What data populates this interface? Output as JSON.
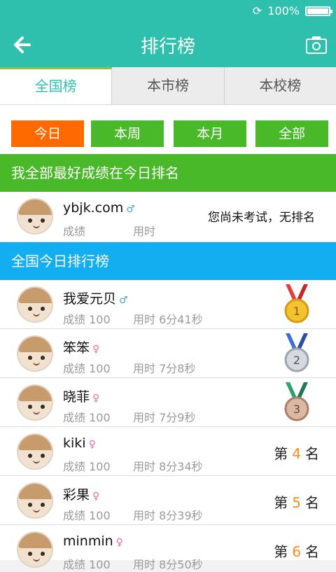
{
  "status": {
    "battery": "100%"
  },
  "header": {
    "title": "排行榜"
  },
  "tabs": [
    {
      "label": "全国榜",
      "active": true
    },
    {
      "label": "本市榜",
      "active": false
    },
    {
      "label": "本校榜",
      "active": false
    }
  ],
  "filters": [
    {
      "label": "今日",
      "active": true
    },
    {
      "label": "本周",
      "active": false
    },
    {
      "label": "本月",
      "active": false
    },
    {
      "label": "全部",
      "active": false
    }
  ],
  "my_section": {
    "title": "我全部最好成绩在今日排名"
  },
  "my_row": {
    "name": "ybjk.com",
    "gender": "♂",
    "score_label": "成绩",
    "time_label": "用时",
    "status": "您尚未考试，无排名"
  },
  "national_section": {
    "title": "全国今日排行榜"
  },
  "ranking": [
    {
      "name": "我爱元贝",
      "gender": "♂",
      "score": "成绩 100",
      "time": "用时 6分41秒",
      "rank": "1",
      "medal": "gold"
    },
    {
      "name": "笨笨",
      "gender": "♀",
      "score": "成绩 100",
      "time": "用时 7分8秒",
      "rank": "2",
      "medal": "silver"
    },
    {
      "name": "晓菲",
      "gender": "♀",
      "score": "成绩 100",
      "time": "用时 7分9秒",
      "rank": "3",
      "medal": "bronze"
    },
    {
      "name": "kiki",
      "gender": "♀",
      "score": "成绩 100",
      "time": "用时 8分34秒",
      "rank_prefix": "第",
      "rank": "4",
      "rank_suffix": "名"
    },
    {
      "name": "彩果",
      "gender": "♀",
      "score": "成绩 100",
      "time": "用时 8分39秒",
      "rank_prefix": "第",
      "rank": "5",
      "rank_suffix": "名"
    },
    {
      "name": "minmin",
      "gender": "♀",
      "score": "成绩 100",
      "time": "用时 8分50秒",
      "rank_prefix": "第",
      "rank": "6",
      "rank_suffix": "名"
    }
  ],
  "colors": {
    "primary": "#2fbfad",
    "green": "#49b92a",
    "orange": "#ff6a00",
    "blue_section": "#12aef0",
    "rank_orange": "#ff8c1a"
  }
}
